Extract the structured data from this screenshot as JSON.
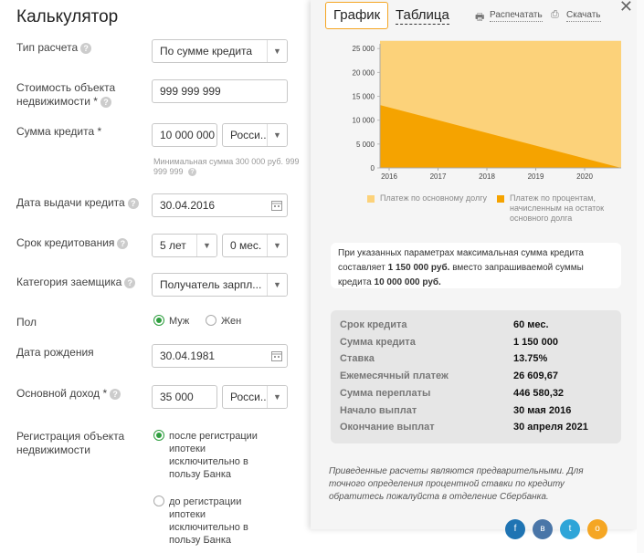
{
  "form": {
    "title": "Калькулятор",
    "calc_type_label": "Тип расчета",
    "calc_type_value": "По сумме кредита",
    "property_cost_label": "Стоимость объекта недвижимости *",
    "property_cost_value": "999 999 999",
    "loan_sum_label": "Сумма кредита *",
    "loan_sum_value": "10 000 000",
    "currency_value": "Росси...",
    "min_hint": "Минимальная сумма 300 000 руб. 999 999 999",
    "issue_date_label": "Дата выдачи кредита",
    "issue_date_value": "30.04.2016",
    "term_label": "Срок кредитования",
    "term_years_value": "5 лет",
    "term_months_value": "0 мес.",
    "borrower_cat_label": "Категория заемщика",
    "borrower_cat_value": "Получатель зарпл...",
    "gender_label": "Пол",
    "gender_male": "Муж",
    "gender_female": "Жен",
    "birth_date_label": "Дата рождения",
    "birth_date_value": "30.04.1981",
    "income_label": "Основной доход *",
    "income_value": "35 000",
    "income_currency_value": "Росси...",
    "registration_label": "Регистрация объекта недвижимости",
    "reg_option_after": "после регистрации ипотеки исключительно в пользу Банка",
    "reg_option_before": "до регистрации ипотеки исключительно в пользу Банка"
  },
  "panel": {
    "tab_chart": "График",
    "tab_table": "Таблица",
    "print_label": "Распечатать",
    "download_label": "Скачать",
    "legend_principal": "Платеж по основному долгу",
    "legend_interest": "Платеж по процентам, начисленным на остаток основного долга",
    "info_pre": "При указанных параметрах максимальная сумма кредита составляет",
    "info_max": "1 150 000 руб.",
    "info_mid": "вместо запрашиваемой суммы кредита",
    "info_requested": "10 000 000 руб.",
    "results": [
      {
        "key": "Срок кредита",
        "value": "60 мес."
      },
      {
        "key": "Сумма кредита",
        "value": "1 150 000"
      },
      {
        "key": "Ставка",
        "value": "13.75%"
      },
      {
        "key": "Ежемесячный платеж",
        "value": "26 609,67"
      },
      {
        "key": "Сумма переплаты",
        "value": "446 580,32"
      },
      {
        "key": "Начало выплат",
        "value": "30 мая 2016"
      },
      {
        "key": "Окончание выплат",
        "value": "30 апреля 2021"
      }
    ],
    "disclaimer": "Приведенные расчеты являются предварительными. Для точного определения процентной ставки по кредиту обратитесь пожалуйста в отделение Сбербанка."
  },
  "colors": {
    "principal": "#fcd27a",
    "interest": "#f5a300",
    "accent": "#f5a623",
    "radio_on": "#2e9e3e"
  },
  "chart_data": {
    "type": "area",
    "x": [
      "2016",
      "2017",
      "2018",
      "2019",
      "2020"
    ],
    "y_ticks": [
      "0",
      "5 000",
      "10 000",
      "15 000",
      "20 000",
      "25 000"
    ],
    "ylim": [
      0,
      26609.67
    ],
    "series": [
      {
        "name": "Платеж по основному долгу",
        "total": 26609.67
      },
      {
        "name": "Платеж по процентам, начисленным на остаток основного долга",
        "start": 13177,
        "end": 0
      }
    ]
  }
}
